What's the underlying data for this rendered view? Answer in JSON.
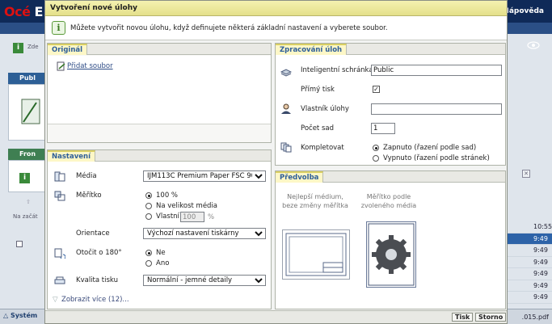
{
  "background": {
    "logo": "Océ E",
    "help": "Nápověda",
    "info_text": "Zde",
    "section_a": "Publ",
    "section_b": "Fron",
    "start_text": "Na začát",
    "times": [
      "10:55",
      "9:49",
      "9:49",
      "9:49",
      "9:49",
      "9:49",
      "9:49",
      "9:49"
    ],
    "system_label": "Systém",
    "file_suffix": ".015.pdf"
  },
  "dialog": {
    "title": "Vytvoření nové úlohy",
    "intro": "Můžete vytvořit novou úlohu, když definujete některá základní nastavení a vyberete soubor."
  },
  "original": {
    "tab": "Originál",
    "add_file": "Přidat soubor"
  },
  "settings": {
    "tab": "Nastavení",
    "media_label": "Média",
    "media_value": "IJM113C Premium Paper FSC 90",
    "scale_label": "Měřítko",
    "scale_options": [
      "100 %",
      "Na velikost média",
      "Vlastní"
    ],
    "scale_custom_value": "100",
    "scale_custom_unit": "%",
    "orientation_label": "Orientace",
    "orientation_value": "Výchozí nastavení tiskárny",
    "rotate_label": "Otočit o 180°",
    "rotate_options": [
      "Ne",
      "Ano"
    ],
    "quality_label": "Kvalita tisku",
    "quality_value": "Normální - jemné detaily",
    "show_more": "Zobrazit více (12)..."
  },
  "processing": {
    "tab": "Zpracování úloh",
    "smart_inbox_label": "Inteligentní schránka",
    "smart_inbox_value": "Public",
    "direct_print_label": "Přímý tisk",
    "owner_label": "Vlastník úlohy",
    "owner_value": "",
    "copies_label": "Počet sad",
    "copies_value": "1",
    "collate_label": "Kompletovat",
    "collate_options": [
      "Zapnuto (řazení podle sad)",
      "Vypnuto (řazení podle stránek)"
    ]
  },
  "preset": {
    "tab": "Předvolba",
    "best_media_title": "Nejlepší médium, beze změny měřítka",
    "scale_media_title": "Měřítko podle zvoleného média"
  },
  "footer": {
    "print": "Tisk",
    "cancel": "Storno"
  },
  "colors": {
    "title_bar": "#e4e08a",
    "tab_text": "#2e5f99",
    "app_header": "#0f2a58"
  }
}
